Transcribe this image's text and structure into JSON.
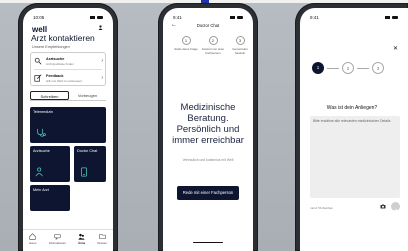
{
  "phone1": {
    "status_time": "10:05",
    "logo": "well",
    "title": "Arzt kontaktieren",
    "section_label": "Unsere Empfehlungen",
    "rows": [
      {
        "title": "Arztsuche",
        "subtitle": "Arzt/Apotheke finden"
      },
      {
        "title": "Feedback",
        "subtitle": "Hilf uns Well zu verbessern"
      }
    ],
    "segments": [
      "Schreiben",
      "Vorbeugen"
    ],
    "tiles": [
      "Telemedizin",
      "Arztsuche",
      "Doctor Chat",
      "Mein Arzt"
    ],
    "tabs": [
      "Home",
      "Informationen",
      "Ärzte",
      "Dossier"
    ]
  },
  "phone2": {
    "status_time": "9:41",
    "nav_title": "Doctor Chat",
    "steps": [
      {
        "num": "1",
        "caption": "Stelle deine Frage"
      },
      {
        "num": "2",
        "caption": "Antwort von einer Fachperson"
      },
      {
        "num": "3",
        "caption": "Gemeinsam handeln"
      }
    ],
    "hero_lines": [
      "Medizinische",
      "Beratung.",
      "Persönlich und",
      "immer erreichbar"
    ],
    "subtitle": "Vertraulich und kostenlos mit Well",
    "cta": "Rede mit einer Fachperson"
  },
  "phone3": {
    "status_time": "9:41",
    "steps": [
      "1",
      "2",
      "3"
    ],
    "question": "Was ist dein Anliegen?",
    "placeholder": "Bitte erwähne alle relevanten medizinischen Details",
    "counter": "mind. 50 Zeichen"
  }
}
